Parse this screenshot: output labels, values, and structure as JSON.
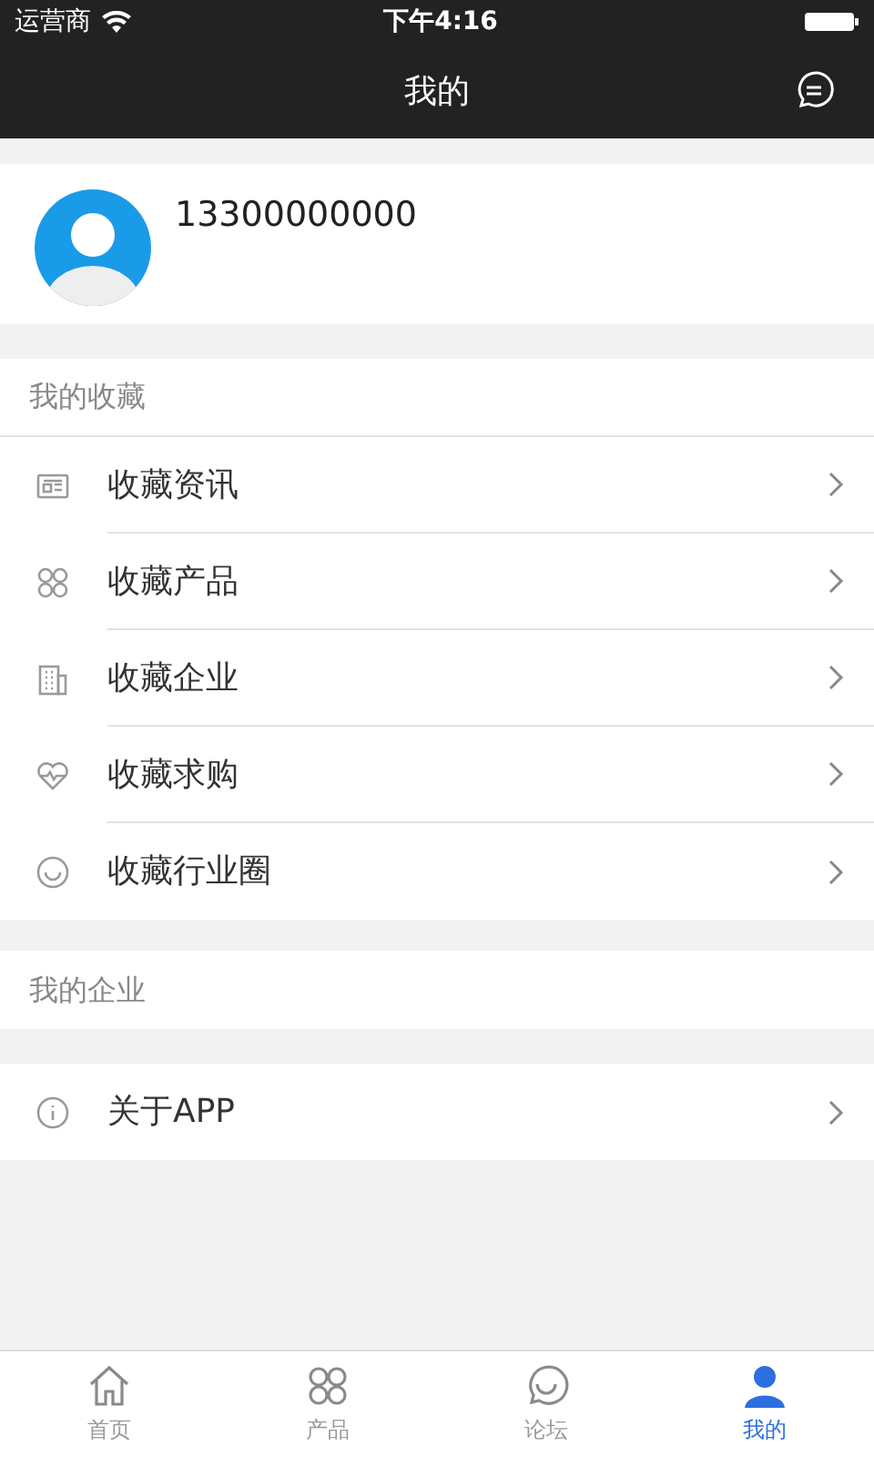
{
  "status_bar": {
    "carrier": "运营商",
    "time": "下午4:16"
  },
  "nav_bar": {
    "title": "我的"
  },
  "profile": {
    "phone": "13300000000"
  },
  "favorites": {
    "header": "我的收藏",
    "items": [
      {
        "kind": "news",
        "label": "收藏资讯"
      },
      {
        "kind": "grid",
        "label": "收藏产品"
      },
      {
        "kind": "building",
        "label": "收藏企业"
      },
      {
        "kind": "heart",
        "label": "收藏求购"
      },
      {
        "kind": "smile",
        "label": "收藏行业圈"
      }
    ]
  },
  "company": {
    "header": "我的企业"
  },
  "about": {
    "kind": "info",
    "label": "关于APP"
  },
  "tabs": [
    {
      "kind": "home",
      "label": "首页",
      "selected": false
    },
    {
      "kind": "grid",
      "label": "产品",
      "selected": false
    },
    {
      "kind": "chat",
      "label": "论坛",
      "selected": false
    },
    {
      "kind": "user",
      "label": "我的",
      "selected": true
    }
  ]
}
